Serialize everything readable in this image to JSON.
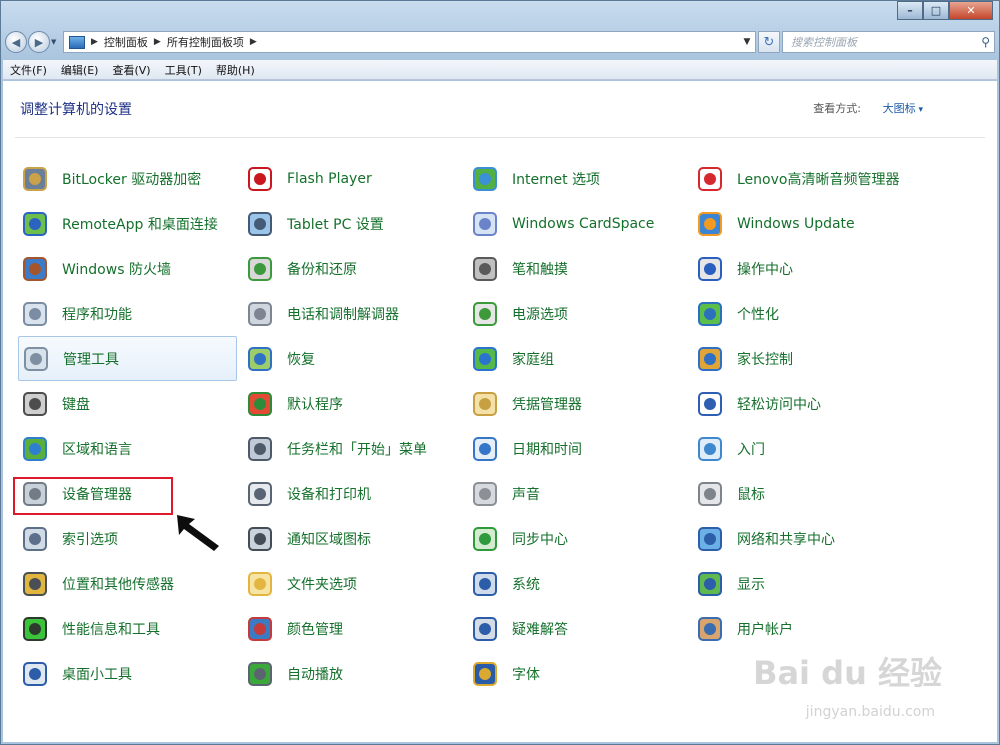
{
  "address": {
    "crumbs": [
      "控制面板",
      "所有控制面板项"
    ],
    "search_placeholder": "搜索控制面板"
  },
  "menu": [
    "文件(F)",
    "编辑(E)",
    "查看(V)",
    "工具(T)",
    "帮助(H)"
  ],
  "header": {
    "title": "调整计算机的设置",
    "view_by_label": "查看方式:",
    "view_by_value": "大图标"
  },
  "items": [
    {
      "label": "BitLocker 驱动器加密",
      "icon": "bitlocker-icon"
    },
    {
      "label": "Flash Player",
      "icon": "flash-icon"
    },
    {
      "label": "Internet 选项",
      "icon": "internet-options-icon"
    },
    {
      "label": "Lenovo高清晰音频管理器",
      "icon": "lenovo-audio-icon"
    },
    {
      "label": "RemoteApp 和桌面连接",
      "icon": "remoteapp-icon"
    },
    {
      "label": "Tablet PC 设置",
      "icon": "tablet-icon"
    },
    {
      "label": "Windows CardSpace",
      "icon": "cardspace-icon"
    },
    {
      "label": "Windows Update",
      "icon": "windows-update-icon"
    },
    {
      "label": "Windows 防火墙",
      "icon": "firewall-icon"
    },
    {
      "label": "备份和还原",
      "icon": "backup-icon"
    },
    {
      "label": "笔和触摸",
      "icon": "pen-icon"
    },
    {
      "label": "操作中心",
      "icon": "flag-icon"
    },
    {
      "label": "程序和功能",
      "icon": "programs-icon"
    },
    {
      "label": "电话和调制解调器",
      "icon": "phone-icon"
    },
    {
      "label": "电源选项",
      "icon": "power-icon"
    },
    {
      "label": "个性化",
      "icon": "personalize-icon"
    },
    {
      "label": "管理工具",
      "icon": "admin-tools-icon"
    },
    {
      "label": "恢复",
      "icon": "recovery-icon"
    },
    {
      "label": "家庭组",
      "icon": "homegroup-icon"
    },
    {
      "label": "家长控制",
      "icon": "parental-icon"
    },
    {
      "label": "键盘",
      "icon": "keyboard-icon"
    },
    {
      "label": "默认程序",
      "icon": "default-programs-icon"
    },
    {
      "label": "凭据管理器",
      "icon": "credential-icon"
    },
    {
      "label": "轻松访问中心",
      "icon": "ease-access-icon"
    },
    {
      "label": "区域和语言",
      "icon": "globe-icon"
    },
    {
      "label": "任务栏和「开始」菜单",
      "icon": "taskbar-icon"
    },
    {
      "label": "日期和时间",
      "icon": "calendar-icon"
    },
    {
      "label": "入门",
      "icon": "getting-started-icon"
    },
    {
      "label": "设备管理器",
      "icon": "device-manager-icon"
    },
    {
      "label": "设备和打印机",
      "icon": "printer-icon"
    },
    {
      "label": "声音",
      "icon": "speaker-icon"
    },
    {
      "label": "鼠标",
      "icon": "mouse-icon"
    },
    {
      "label": "索引选项",
      "icon": "index-icon"
    },
    {
      "label": "通知区域图标",
      "icon": "notification-icon"
    },
    {
      "label": "同步中心",
      "icon": "sync-icon"
    },
    {
      "label": "网络和共享中心",
      "icon": "network-icon"
    },
    {
      "label": "位置和其他传感器",
      "icon": "sensor-icon"
    },
    {
      "label": "文件夹选项",
      "icon": "folder-icon"
    },
    {
      "label": "系统",
      "icon": "system-icon"
    },
    {
      "label": "显示",
      "icon": "display-icon"
    },
    {
      "label": "性能信息和工具",
      "icon": "performance-icon"
    },
    {
      "label": "颜色管理",
      "icon": "color-icon"
    },
    {
      "label": "疑难解答",
      "icon": "troubleshoot-icon"
    },
    {
      "label": "用户帐户",
      "icon": "users-icon"
    },
    {
      "label": "桌面小工具",
      "icon": "gadgets-icon"
    },
    {
      "label": "自动播放",
      "icon": "autoplay-icon"
    },
    {
      "label": "字体",
      "icon": "font-icon"
    }
  ],
  "watermark": {
    "brand": "Bai du 经验",
    "url": "jingyan.baidu.com"
  },
  "colors": {
    "link_green": "#15702c",
    "heading_blue": "#1e3287",
    "highlight_red": "#e0192a"
  }
}
